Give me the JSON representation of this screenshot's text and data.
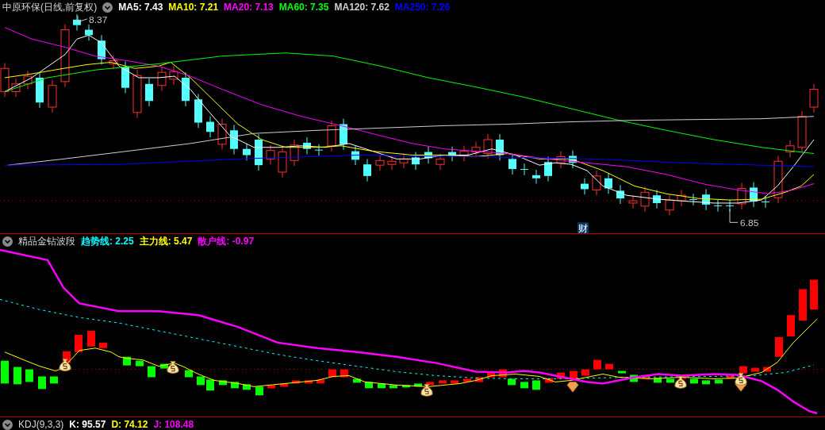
{
  "price_panel": {
    "title": "中原环保(日线,前复权)",
    "indicators": [
      {
        "label": "MA5: 7.43",
        "color": "#ffffff"
      },
      {
        "label": "MA10: 7.21",
        "color": "#ffff00"
      },
      {
        "label": "MA20: 7.13",
        "color": "#ff00ff"
      },
      {
        "label": "MA60: 7.35",
        "color": "#00ff00"
      },
      {
        "label": "MA120: 7.62",
        "color": "#d0d0d0"
      },
      {
        "label": "MA250: 7.26",
        "color": "#0000ff"
      }
    ],
    "high_label": "8.37",
    "low_label": "6.85",
    "event_badge": "财"
  },
  "indicator_panel": {
    "title": "精品金钻波段",
    "indicators": [
      {
        "label": "趋势线: 2.25",
        "color": "#00ffff"
      },
      {
        "label": "主力线: 5.47",
        "color": "#ffff00"
      },
      {
        "label": "散户线: -0.97",
        "color": "#ff00ff"
      }
    ]
  },
  "kd_panel": {
    "title": "KDJ(9,3,3)",
    "indicators": [
      {
        "label": "K: 95.57",
        "color": "#ffffff"
      },
      {
        "label": "D: 74.12",
        "color": "#ffff00"
      },
      {
        "label": "J: 108.48",
        "color": "#ff00ff"
      }
    ]
  }
}
